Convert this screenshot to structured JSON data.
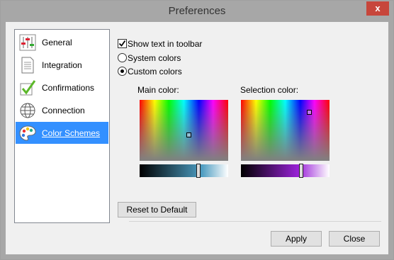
{
  "window": {
    "title": "Preferences",
    "close_glyph": "x"
  },
  "sidebar": {
    "items": [
      {
        "label": "General",
        "icon": "sliders-icon"
      },
      {
        "label": "Integration",
        "icon": "document-icon"
      },
      {
        "label": "Confirmations",
        "icon": "checkmark-icon"
      },
      {
        "label": "Connection",
        "icon": "globe-icon"
      },
      {
        "label": "Color Schemes",
        "icon": "palette-icon",
        "selected": true
      }
    ]
  },
  "options": {
    "show_text": {
      "label": "Show text in toolbar",
      "checked": true
    },
    "system_colors": {
      "label": "System colors",
      "selected": false
    },
    "custom_colors": {
      "label": "Custom colors",
      "selected": true
    }
  },
  "main_color": {
    "label": "Main color:",
    "slider_start": "#000000",
    "slider_mid": "#4b9bc0",
    "slider_end": "#ffffff"
  },
  "selection_color": {
    "label": "Selection color:",
    "slider_start": "#000000",
    "slider_mid": "#9a22d8",
    "slider_end": "#ffffff"
  },
  "buttons": {
    "reset": "Reset to Default",
    "apply": "Apply",
    "close": "Close"
  }
}
